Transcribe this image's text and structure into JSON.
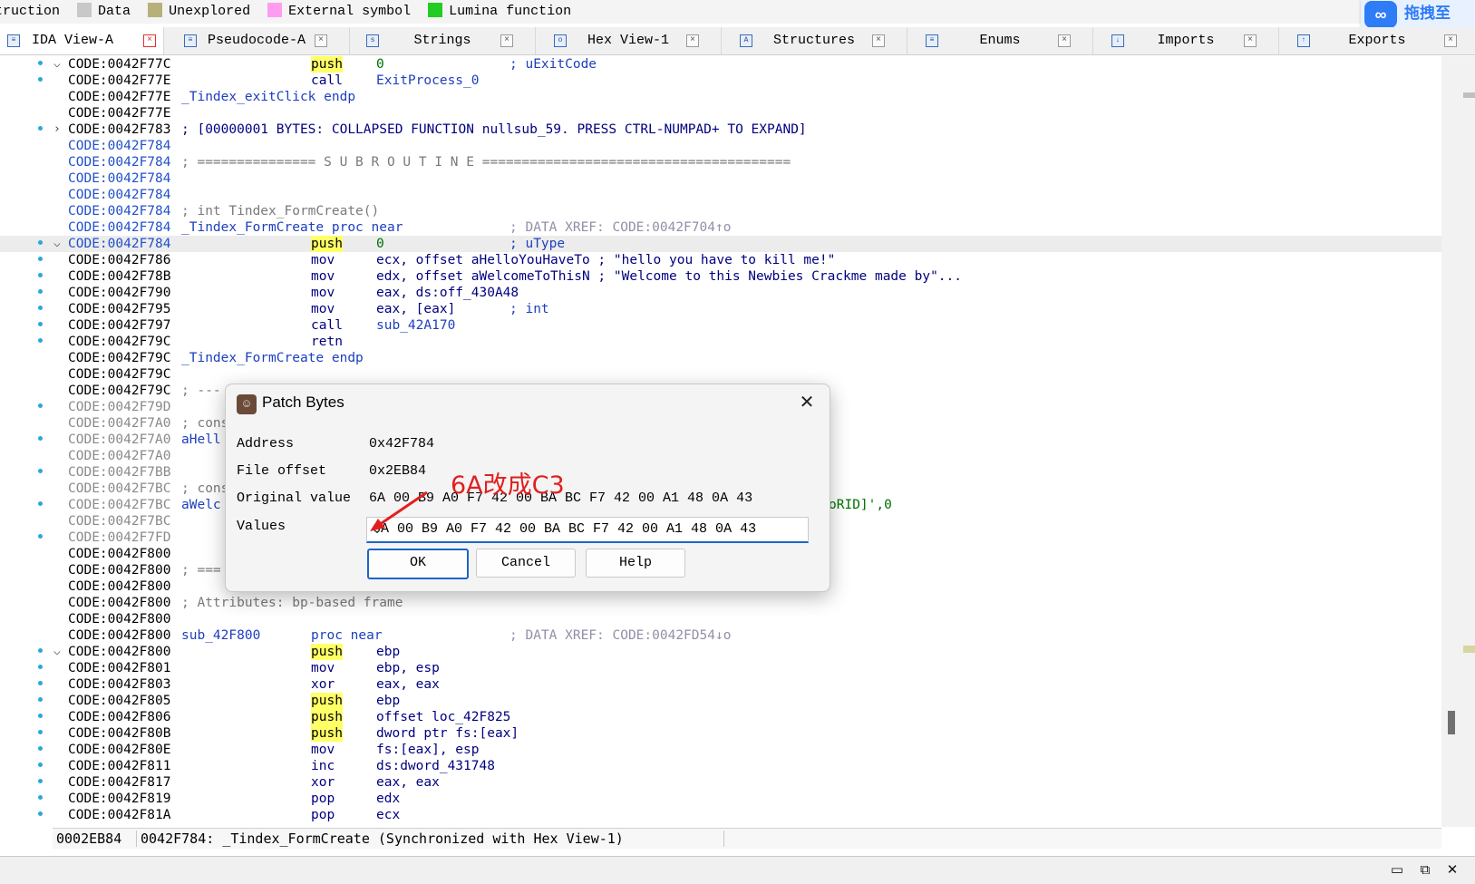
{
  "legend": [
    {
      "label": "truction",
      "color": ""
    },
    {
      "label": "Data",
      "color": "#c8c8c8"
    },
    {
      "label": "Unexplored",
      "color": "#b8b07a"
    },
    {
      "label": "External symbol",
      "color": "#ff9cf0"
    },
    {
      "label": "Lumina function",
      "color": "#22cc22"
    }
  ],
  "baidu_label": "拖拽至",
  "tabs": [
    {
      "label": "IDA View-A",
      "active": true,
      "icon": "ida-view-icon"
    },
    {
      "label": "Pseudocode-A",
      "active": false,
      "icon": "pseudocode-icon"
    },
    {
      "label": "Strings",
      "active": false,
      "icon": "strings-icon"
    },
    {
      "label": "Hex View-1",
      "active": false,
      "icon": "hex-view-icon"
    },
    {
      "label": "Structures",
      "active": false,
      "icon": "structures-icon"
    },
    {
      "label": "Enums",
      "active": false,
      "icon": "enums-icon"
    },
    {
      "label": "Imports",
      "active": false,
      "icon": "imports-icon"
    },
    {
      "label": "Exports",
      "active": false,
      "icon": "exports-icon"
    }
  ],
  "code": [
    {
      "dot": true,
      "chev": "v",
      "addr": "CODE:0042F77C",
      "ac": "",
      "c1": "",
      "c1c": "",
      "c2": "push",
      "c2c": "push",
      "c3": "0",
      "c3c": "green",
      "c4": "; uExitCode",
      "c4c": "blue"
    },
    {
      "dot": true,
      "chev": "",
      "addr": "CODE:0042F77E",
      "ac": "",
      "c1": "",
      "c1c": "",
      "c2": "call",
      "c2c": "navy",
      "c3": "ExitProcess_0",
      "c3c": "blue",
      "c4": "",
      "c4c": ""
    },
    {
      "dot": false,
      "chev": "",
      "addr": "CODE:0042F77E",
      "ac": "",
      "c1": "_Tindex_exitClick endp",
      "c1c": "blue",
      "c2": "",
      "c2c": "",
      "c3": "",
      "c3c": "",
      "c4": "",
      "c4c": ""
    },
    {
      "dot": false,
      "chev": "",
      "addr": "CODE:0042F77E",
      "ac": "",
      "c1": "",
      "c1c": "",
      "c2": "",
      "c2c": "",
      "c3": "",
      "c3c": "",
      "c4": "",
      "c4c": ""
    },
    {
      "dot": true,
      "chev": ">",
      "addr": "CODE:0042F783",
      "ac": "",
      "c1": "; [00000001 BYTES: COLLAPSED FUNCTION nullsub_59. PRESS CTRL-NUMPAD+ TO EXPAND]",
      "c1c": "dblue",
      "c2": "",
      "c2c": "",
      "c3": "",
      "c3c": "",
      "c4": "",
      "c4c": ""
    },
    {
      "dot": false,
      "chev": "",
      "addr": "CODE:0042F784",
      "ac": "blue",
      "c1": "",
      "c1c": "",
      "c2": "",
      "c2c": "",
      "c3": "",
      "c3c": "",
      "c4": "",
      "c4c": ""
    },
    {
      "dot": false,
      "chev": "",
      "addr": "CODE:0042F784",
      "ac": "blue",
      "c1": "; =============== S U B R O U T I N E =======================================",
      "c1c": "gray",
      "c2": "",
      "c2c": "",
      "c3": "",
      "c3c": "",
      "c4": "",
      "c4c": ""
    },
    {
      "dot": false,
      "chev": "",
      "addr": "CODE:0042F784",
      "ac": "blue",
      "c1": "",
      "c1c": "",
      "c2": "",
      "c2c": "",
      "c3": "",
      "c3c": "",
      "c4": "",
      "c4c": ""
    },
    {
      "dot": false,
      "chev": "",
      "addr": "CODE:0042F784",
      "ac": "blue",
      "c1": "",
      "c1c": "",
      "c2": "",
      "c2c": "",
      "c3": "",
      "c3c": "",
      "c4": "",
      "c4c": ""
    },
    {
      "dot": false,
      "chev": "",
      "addr": "CODE:0042F784",
      "ac": "blue",
      "c1": "; int Tindex_FormCreate()",
      "c1c": "gray",
      "c2": "",
      "c2c": "",
      "c3": "",
      "c3c": "",
      "c4": "",
      "c4c": ""
    },
    {
      "dot": false,
      "chev": "",
      "addr": "CODE:0042F784",
      "ac": "blue",
      "c1": "_Tindex_FormCreate proc near",
      "c1c": "blue",
      "c2": "",
      "c2c": "",
      "c3": "",
      "c3c": "",
      "c4": "; DATA XREF: CODE:0042F704↑o",
      "c4c": "lgray"
    },
    {
      "dot": true,
      "chev": "v",
      "addr": "CODE:0042F784",
      "ac": "blue",
      "hl": true,
      "c1": "",
      "c1c": "",
      "c2": "push",
      "c2c": "push",
      "c3": "0",
      "c3c": "green",
      "c4": "; uType",
      "c4c": "blue"
    },
    {
      "dot": true,
      "chev": "",
      "addr": "CODE:0042F786",
      "ac": "",
      "c1": "",
      "c1c": "",
      "c2": "mov",
      "c2c": "navy",
      "c3": "ecx, offset aHelloYouHaveTo ; \"hello you have to kill me!\"",
      "c3c": "navy",
      "c4": "",
      "c4c": ""
    },
    {
      "dot": true,
      "chev": "",
      "addr": "CODE:0042F78B",
      "ac": "",
      "c1": "",
      "c1c": "",
      "c2": "mov",
      "c2c": "navy",
      "c3": "edx, offset aWelcomeToThisN ; \"Welcome to this Newbies Crackme made by\"...",
      "c3c": "navy",
      "c4": "",
      "c4c": ""
    },
    {
      "dot": true,
      "chev": "",
      "addr": "CODE:0042F790",
      "ac": "",
      "c1": "",
      "c1c": "",
      "c2": "mov",
      "c2c": "navy",
      "c3": "eax, ds:off_430A48",
      "c3c": "navy",
      "c4": "",
      "c4c": ""
    },
    {
      "dot": true,
      "chev": "",
      "addr": "CODE:0042F795",
      "ac": "",
      "c1": "",
      "c1c": "",
      "c2": "mov",
      "c2c": "navy",
      "c3": "eax, [eax]",
      "c3c": "navy",
      "c4": "; int",
      "c4c": "blue"
    },
    {
      "dot": true,
      "chev": "",
      "addr": "CODE:0042F797",
      "ac": "",
      "c1": "",
      "c1c": "",
      "c2": "call",
      "c2c": "navy",
      "c3": "sub_42A170",
      "c3c": "blue",
      "c4": "",
      "c4c": ""
    },
    {
      "dot": true,
      "chev": "",
      "addr": "CODE:0042F79C",
      "ac": "",
      "c1": "",
      "c1c": "",
      "c2": "retn",
      "c2c": "navy",
      "c3": "",
      "c3c": "",
      "c4": "",
      "c4c": ""
    },
    {
      "dot": false,
      "chev": "",
      "addr": "CODE:0042F79C",
      "ac": "",
      "c1": "_Tindex_FormCreate endp",
      "c1c": "blue",
      "c2": "",
      "c2c": "",
      "c3": "",
      "c3c": "",
      "c4": "",
      "c4c": ""
    },
    {
      "dot": false,
      "chev": "",
      "addr": "CODE:0042F79C",
      "ac": "",
      "c1": "",
      "c1c": "",
      "c2": "",
      "c2c": "",
      "c3": "",
      "c3c": "",
      "c4": "",
      "c4c": ""
    },
    {
      "dot": false,
      "chev": "",
      "addr": "CODE:0042F79C",
      "ac": "",
      "c1": "; ---",
      "c1c": "gray",
      "c2": "",
      "c2c": "",
      "c3": "",
      "c3c": "",
      "c4": "",
      "c4c": ""
    },
    {
      "dot": true,
      "chev": "",
      "addr": "CODE:0042F79D",
      "ac": "gray",
      "c1": "",
      "c1c": "",
      "c2": "",
      "c2c": "",
      "c3": "",
      "c3c": "",
      "c4": "",
      "c4c": ""
    },
    {
      "dot": false,
      "chev": "",
      "addr": "CODE:0042F7A0",
      "ac": "gray",
      "c1": "; cons",
      "c1c": "gray",
      "c2": "",
      "c2c": "",
      "c3": "",
      "c3c": "",
      "c4": "",
      "c4c": ""
    },
    {
      "dot": true,
      "chev": "",
      "addr": "CODE:0042F7A0",
      "ac": "gray",
      "c1": "aHell",
      "c1c": "blue",
      "c2": "",
      "c2c": "",
      "c3": "",
      "c3c": "",
      "c4": "",
      "c4c": ""
    },
    {
      "dot": false,
      "chev": "",
      "addr": "CODE:0042F7A0",
      "ac": "gray",
      "c1": "",
      "c1c": "",
      "c2": "",
      "c2c": "",
      "c3": "",
      "c3c": "",
      "c4": "",
      "c4c": ""
    },
    {
      "dot": true,
      "chev": "",
      "addr": "CODE:0042F7BB",
      "ac": "gray",
      "c1": "",
      "c1c": "",
      "c2": "",
      "c2c": "",
      "c3": "",
      "c3c": "",
      "c4": "",
      "c4c": ""
    },
    {
      "dot": false,
      "chev": "",
      "addr": "CODE:0042F7BC",
      "ac": "gray",
      "c1": "; cons",
      "c1c": "gray",
      "c2": "",
      "c2c": "",
      "c3": "",
      "c3c": "",
      "c4": "",
      "c4c": ""
    },
    {
      "dot": true,
      "chev": "",
      "addr": "CODE:0042F7BC",
      "ac": "gray",
      "c1": "aWelc",
      "c1c": "blue",
      "c2": "",
      "c2c": "",
      "c3": "",
      "c3c": "",
      "c4": "",
      "c4c": "",
      "tail": "oRID]',0"
    },
    {
      "dot": false,
      "chev": "",
      "addr": "CODE:0042F7BC",
      "ac": "gray",
      "c1": "",
      "c1c": "",
      "c2": "",
      "c2c": "",
      "c3": "",
      "c3c": "",
      "c4": "",
      "c4c": ""
    },
    {
      "dot": true,
      "chev": "",
      "addr": "CODE:0042F7FD",
      "ac": "gray",
      "c1": "",
      "c1c": "",
      "c2": "",
      "c2c": "",
      "c3": "",
      "c3c": "",
      "c4": "",
      "c4c": ""
    },
    {
      "dot": false,
      "chev": "",
      "addr": "CODE:0042F800",
      "ac": "",
      "c1": "",
      "c1c": "",
      "c2": "",
      "c2c": "",
      "c3": "",
      "c3c": "",
      "c4": "",
      "c4c": ""
    },
    {
      "dot": false,
      "chev": "",
      "addr": "CODE:0042F800",
      "ac": "",
      "c1": "; ===",
      "c1c": "gray",
      "c2": "",
      "c2c": "",
      "c3": "",
      "c3c": "",
      "c4": "",
      "c4c": ""
    },
    {
      "dot": false,
      "chev": "",
      "addr": "CODE:0042F800",
      "ac": "",
      "c1": "",
      "c1c": "",
      "c2": "",
      "c2c": "",
      "c3": "",
      "c3c": "",
      "c4": "",
      "c4c": ""
    },
    {
      "dot": false,
      "chev": "",
      "addr": "CODE:0042F800",
      "ac": "",
      "c1": "; Attributes: bp-based frame",
      "c1c": "gray",
      "c2": "",
      "c2c": "",
      "c3": "",
      "c3c": "",
      "c4": "",
      "c4c": ""
    },
    {
      "dot": false,
      "chev": "",
      "addr": "CODE:0042F800",
      "ac": "",
      "c1": "",
      "c1c": "",
      "c2": "",
      "c2c": "",
      "c3": "",
      "c3c": "",
      "c4": "",
      "c4c": ""
    },
    {
      "dot": false,
      "chev": "",
      "addr": "CODE:0042F800",
      "ac": "",
      "c1": "sub_42F800",
      "c1c": "blue",
      "c2": "proc near",
      "c2c": "blue",
      "c3": "",
      "c3c": "",
      "c4": "; DATA XREF: CODE:0042FD54↓o",
      "c4c": "lgray"
    },
    {
      "dot": true,
      "chev": "v",
      "addr": "CODE:0042F800",
      "ac": "",
      "c1": "",
      "c1c": "",
      "c2": "push",
      "c2c": "push",
      "c3": "ebp",
      "c3c": "navy",
      "c4": "",
      "c4c": ""
    },
    {
      "dot": true,
      "chev": "",
      "addr": "CODE:0042F801",
      "ac": "",
      "c1": "",
      "c1c": "",
      "c2": "mov",
      "c2c": "navy",
      "c3": "ebp, esp",
      "c3c": "navy",
      "c4": "",
      "c4c": ""
    },
    {
      "dot": true,
      "chev": "",
      "addr": "CODE:0042F803",
      "ac": "",
      "c1": "",
      "c1c": "",
      "c2": "xor",
      "c2c": "navy",
      "c3": "eax, eax",
      "c3c": "navy",
      "c4": "",
      "c4c": ""
    },
    {
      "dot": true,
      "chev": "",
      "addr": "CODE:0042F805",
      "ac": "",
      "c1": "",
      "c1c": "",
      "c2": "push",
      "c2c": "push",
      "c3": "ebp",
      "c3c": "navy",
      "c4": "",
      "c4c": ""
    },
    {
      "dot": true,
      "chev": "",
      "addr": "CODE:0042F806",
      "ac": "",
      "c1": "",
      "c1c": "",
      "c2": "push",
      "c2c": "push",
      "c3": "offset loc_42F825",
      "c3c": "navy",
      "c4": "",
      "c4c": ""
    },
    {
      "dot": true,
      "chev": "",
      "addr": "CODE:0042F80B",
      "ac": "",
      "c1": "",
      "c1c": "",
      "c2": "push",
      "c2c": "push",
      "c3": "dword ptr fs:[eax]",
      "c3c": "navy",
      "c4": "",
      "c4c": ""
    },
    {
      "dot": true,
      "chev": "",
      "addr": "CODE:0042F80E",
      "ac": "",
      "c1": "",
      "c1c": "",
      "c2": "mov",
      "c2c": "navy",
      "c3": "fs:[eax], esp",
      "c3c": "navy",
      "c4": "",
      "c4c": ""
    },
    {
      "dot": true,
      "chev": "",
      "addr": "CODE:0042F811",
      "ac": "",
      "c1": "",
      "c1c": "",
      "c2": "inc",
      "c2c": "navy",
      "c3": "ds:dword_431748",
      "c3c": "navy",
      "c4": "",
      "c4c": ""
    },
    {
      "dot": true,
      "chev": "",
      "addr": "CODE:0042F817",
      "ac": "",
      "c1": "",
      "c1c": "",
      "c2": "xor",
      "c2c": "navy",
      "c3": "eax, eax",
      "c3c": "navy",
      "c4": "",
      "c4c": ""
    },
    {
      "dot": true,
      "chev": "",
      "addr": "CODE:0042F819",
      "ac": "",
      "c1": "",
      "c1c": "",
      "c2": "pop",
      "c2c": "navy",
      "c3": "edx",
      "c3c": "navy",
      "c4": "",
      "c4c": ""
    },
    {
      "dot": true,
      "chev": "",
      "addr": "CODE:0042F81A",
      "ac": "",
      "c1": "",
      "c1c": "",
      "c2": "pop",
      "c2c": "navy",
      "c3": "ecx",
      "c3c": "navy",
      "c4": "",
      "c4c": ""
    }
  ],
  "status": {
    "offset": "0002EB84",
    "location": "0042F784: _Tindex_FormCreate (Synchronized with Hex View-1)"
  },
  "dialog": {
    "title": "Patch Bytes",
    "address_label": "Address",
    "address_value": "0x42F784",
    "offset_label": "File offset",
    "offset_value": "0x2EB84",
    "original_label": "Original value",
    "original_value": "6A 00 B9 A0 F7 42 00 BA BC F7 42 00 A1 48 0A 43",
    "values_label": "Values",
    "values_value": "6A 00 B9 A0 F7 42 00 BA BC F7 42 00 A1 48 0A 43",
    "ok": "OK",
    "cancel": "Cancel",
    "help": "Help"
  },
  "annotation": "6A改成C3"
}
